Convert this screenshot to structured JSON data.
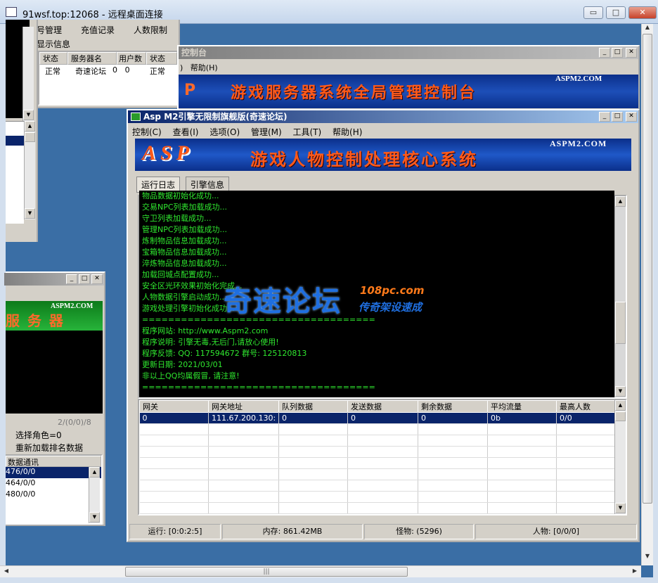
{
  "rdp": {
    "title": "91wsf.top:12068 - 远程桌面连接",
    "min": "▭",
    "max": "□",
    "close": "✕"
  },
  "bg_top_win": {
    "menu": [
      "号管理",
      "充值记录",
      "人数限制"
    ],
    "sub": "显示信息",
    "headers": [
      "状态",
      "服务器名",
      "用户数",
      "状态"
    ],
    "row": [
      "正常",
      "奇速论坛",
      "0",
      "0",
      "正常"
    ]
  },
  "console_win": {
    "title": "控制台",
    "menu_tail": ")",
    "help": "帮助(H)",
    "banner_text": "游戏服务器系统全局管理控制台",
    "banner_left": "P",
    "brand": "ASPM2.COM"
  },
  "left_win": {
    "banner_text": "服 务 器",
    "brand": "ASPM2.COM",
    "counter": "2/(0/0)/8",
    "label1": "选择角色=0",
    "label2": "重新加载排名数据",
    "list_header": "数据通讯",
    "list": [
      "476/0/0",
      "464/0/0",
      "480/0/0"
    ]
  },
  "main_win": {
    "title": "Asp M2引擎无限制旗舰版(奇速论坛)",
    "menu": [
      "控制(C)",
      "查看(I)",
      "选项(O)",
      "管理(M)",
      "工具(T)",
      "帮助(H)"
    ],
    "banner_left": "ASP",
    "banner_text": "游戏人物控制处理核心系统",
    "brand": "ASPM2.COM",
    "tabs": [
      "运行日志",
      "引擎信息"
    ],
    "log": [
      "物品数据初始化成功...",
      "交易NPC列表加载成功...",
      "守卫列表加载成功...",
      "管理NPC列表加载成功...",
      "炼制物品信息加载成功...",
      "宝箱物品信息加载成功...",
      "淬炼物品信息加载成功...",
      "加载回城点配置成功...",
      "安全区光环效果初始化完成...",
      "人物数据引擎启动成功...",
      "游戏处理引擎初始化成功...",
      "====================================",
      "程序网站: http://www.Aspm2.com",
      "程序说明: 引擎无毒,无后门,请放心使用!",
      "程序反馈: QQ: 117594672 群号: 125120813",
      "更新日期: 2021/03/01",
      "非以上QQ均属假冒, 请注意!",
      "===================================="
    ],
    "table_headers": [
      "网关",
      "网关地址",
      "队列数据",
      "发送数据",
      "剩余数据",
      "平均流量",
      "最高人数"
    ],
    "table_row": [
      "0",
      "111.67.200.130:",
      "0",
      "0",
      "0",
      "0b",
      "0/0"
    ],
    "status": [
      "运行: [0:0:2:5]",
      "内存: 861.42MB",
      "怪物: (5296)",
      "人物: [0/0/0]"
    ]
  },
  "watermark": {
    "main": "奇速论坛",
    "site": "108pc.com",
    "sub": "传奇架设速成"
  }
}
